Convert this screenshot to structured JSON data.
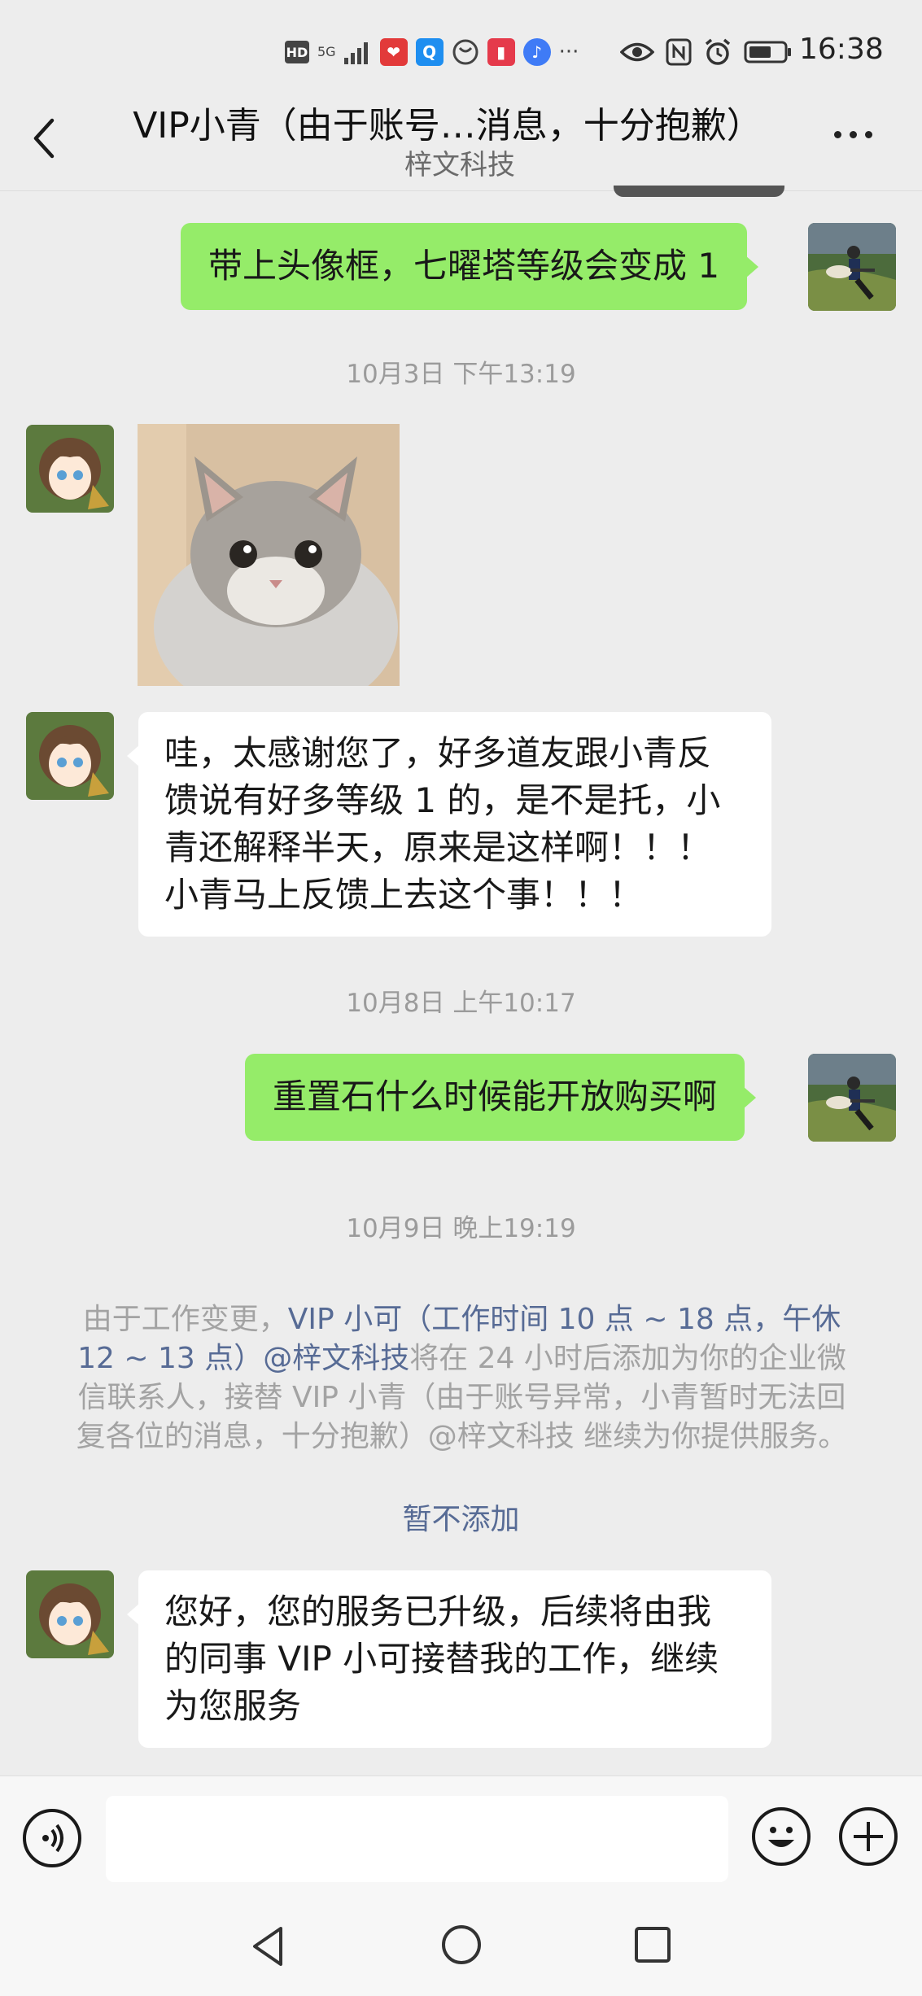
{
  "status_bar": {
    "time": "16:38",
    "indicators": [
      "HD",
      "5G",
      "signal-icon",
      "app-icon-red",
      "search-app-icon",
      "browser-icon",
      "book-app-icon",
      "music-app-icon",
      "more-notifications-icon",
      "eye-icon",
      "nfc-icon",
      "alarm-icon",
      "battery-icon"
    ],
    "hd_label": "HD",
    "network_label": "5G",
    "more_label": "···"
  },
  "header": {
    "title": "VIP小青（由于账号…消息，十分抱歉）",
    "subtitle": "梓文科技"
  },
  "messages": [
    {
      "type": "outgoing_text",
      "text": "带上头像框，七曜塔等级会变成 1"
    },
    {
      "type": "timestamp",
      "text": "10月3日 下午13:19"
    },
    {
      "type": "incoming_image",
      "image_icon": "cat-sticker"
    },
    {
      "type": "incoming_text",
      "lines": [
        "哇，太感谢您了，好多道友跟小青反",
        "馈说有好多等级 1 的，是不是托，小",
        "青还解释半天，原来是这样啊！！！",
        "小青马上反馈上去这个事！！！"
      ]
    },
    {
      "type": "timestamp",
      "text": "10月8日 上午10:17"
    },
    {
      "type": "outgoing_text",
      "text": "重置石什么时候能开放购买啊"
    },
    {
      "type": "timestamp",
      "text": "10月9日 晚上19:19"
    },
    {
      "type": "incoming_text",
      "lines": [
        "您好，您的服务已升级，后续将由我",
        "的同事 VIP 小可接替我的工作，继续",
        "为您服务"
      ]
    }
  ],
  "system_message": {
    "prefix": "由于工作变更，",
    "link_1": "VIP 小可（工作时间 10 点 ~ 18 点，午休 12 ~ 13 点）@梓文科技",
    "suffix": "将在 24 小时后添加为你的企业微信联系人，接替 VIP 小青（由于账号异常，小青暂时无法回复各位的消息，十分抱歉）@梓文科技 继续为你提供服务。",
    "action": "暂不添加"
  },
  "input_bar": {
    "voice_icon": "voice-icon",
    "emoji_icon": "emoji-icon",
    "plus_icon": "plus-icon",
    "placeholder": ""
  },
  "nav_bar": {
    "icons": [
      "back-triangle-icon",
      "home-circle-icon",
      "recents-square-icon"
    ]
  },
  "colors": {
    "background": "#ededed",
    "outgoing_bubble": "#95ec69",
    "incoming_bubble": "#ffffff",
    "link": "#576b95",
    "timestamp": "#9b9b9b"
  }
}
